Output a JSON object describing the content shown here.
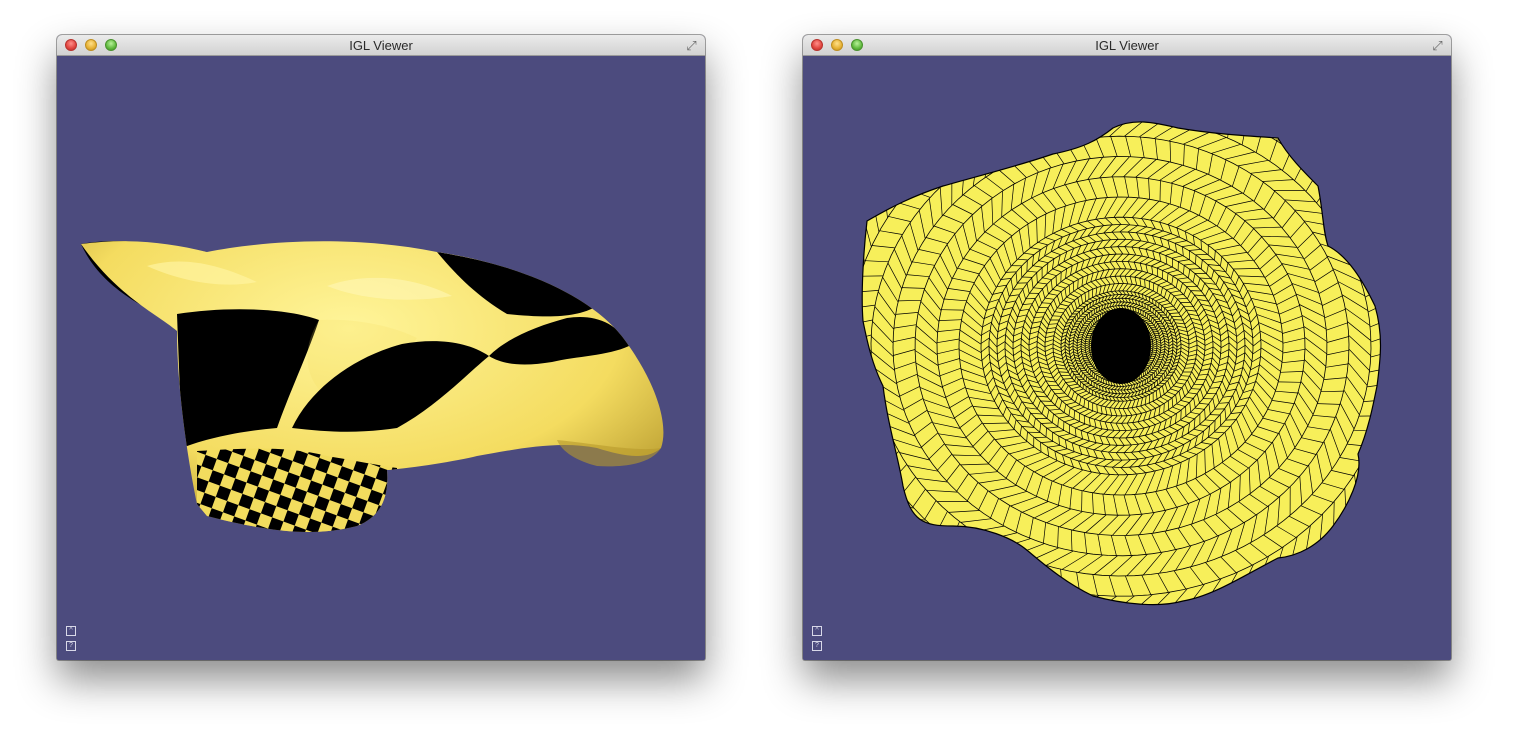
{
  "windows": [
    {
      "title": "IGL Viewer",
      "controls": {
        "close": "close-icon",
        "minimize": "minimize-icon",
        "zoom": "zoom-icon",
        "fullscreen": "fullscreen-icon"
      },
      "viewport_background": "#4c4b7e",
      "overlay_buttons": [
        {
          "icon": "expand-panel-icon",
          "glyph": "^"
        },
        {
          "icon": "help-icon",
          "glyph": "?"
        }
      ]
    },
    {
      "title": "IGL Viewer",
      "controls": {
        "close": "close-icon",
        "minimize": "minimize-icon",
        "zoom": "zoom-icon",
        "fullscreen": "fullscreen-icon"
      },
      "viewport_background": "#4c4b7e",
      "overlay_buttons": [
        {
          "icon": "expand-panel-icon",
          "glyph": "^"
        },
        {
          "icon": "help-icon",
          "glyph": "?"
        }
      ]
    }
  ],
  "colors": {
    "mesh_yellow": "#f7ef5a",
    "shade_yellow": "#ffe873",
    "checker_black": "#000000",
    "wire": "#000000"
  }
}
